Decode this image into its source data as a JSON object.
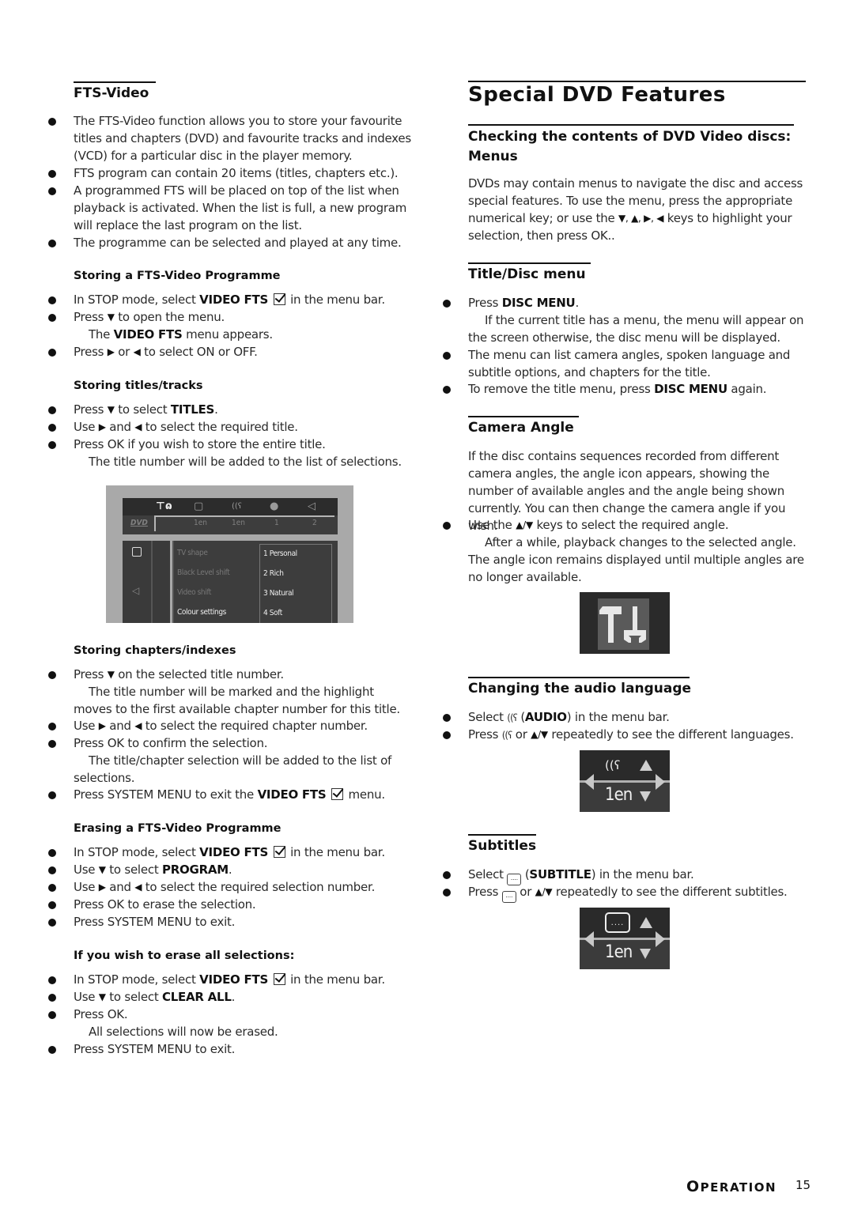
{
  "left": {
    "fts_heading": "FTS-Video",
    "intro_bullets": [
      "The FTS-Video function allows you to store your favourite titles and chapters (DVD) and favourite tracks and indexes (VCD) for a particular disc in the player memory.",
      "FTS program can contain 20 items (titles, chapters etc.).",
      "A programmed FTS will be placed on top of the list when playback is activated. When the list is full, a new program will replace the last program on the list.",
      "The programme can be selected and played at any time."
    ],
    "storing_programme": {
      "heading": "Storing a FTS-Video Programme",
      "b1_pre": "In STOP mode, select ",
      "b1_bold": "VIDEO FTS",
      "b1_post": " in the menu bar.",
      "b2_pre": "Press ",
      "b2_post": " to open the menu.",
      "b2_sub_pre": "The ",
      "b2_sub_bold": "VIDEO FTS",
      "b2_sub_post": " menu appears.",
      "b3_pre": "Press ",
      "b3_mid": " or ",
      "b3_post": "  to select ON or OFF."
    },
    "storing_titles": {
      "heading": "Storing titles/tracks",
      "b1_pre": "Press ",
      "b1_mid": " to select ",
      "b1_bold": "TITLES",
      "b1_post": ".",
      "b2_pre": "Use ",
      "b2_mid": " and ",
      "b2_post": " to select the required title.",
      "b3": "Press OK if you wish to store the entire title.",
      "b3_sub": "The title number will be added to the list of selections."
    },
    "osd_menu": {
      "top_values": [
        "1en",
        "1en",
        "1",
        "2"
      ],
      "disc_logo": "DVD",
      "labels": [
        "TV shape",
        "Black Level shift",
        "Video shift",
        "Colour settings"
      ],
      "options": [
        "1 Personal",
        "2 Rich",
        "3 Natural",
        "4 Soft"
      ]
    },
    "storing_chapters": {
      "heading": "Storing chapters/indexes",
      "b1_pre": "Press ",
      "b1_post": " on the selected title number.",
      "b1_sub": "The title number will be marked and the highlight moves to the first available chapter number for this title.",
      "b2_pre": "Use ",
      "b2_mid": " and ",
      "b2_post": " to select the required chapter number.",
      "b3": "Press OK to confirm the selection.",
      "b3_sub": "The title/chapter selection will be added to the list of selections.",
      "b4_pre": "Press SYSTEM MENU to exit the ",
      "b4_bold": "VIDEO FTS",
      "b4_post": " menu."
    },
    "erasing_programme": {
      "heading": "Erasing a FTS-Video Programme",
      "b1_pre": "In STOP mode, select ",
      "b1_bold": "VIDEO FTS",
      "b1_post": " in the menu bar.",
      "b2_pre": "Use ",
      "b2_mid": " to select ",
      "b2_bold": "PROGRAM",
      "b2_post": ".",
      "b3_pre": "Use ",
      "b3_mid": " and ",
      "b3_post": " to select the required selection number.",
      "b4": "Press OK to erase the selection.",
      "b5": "Press SYSTEM MENU to exit."
    },
    "erase_all": {
      "heading": "If you wish to erase all selections:",
      "b1_pre": "In STOP mode, select ",
      "b1_bold": "VIDEO FTS",
      "b1_post": " in the menu bar.",
      "b2_pre": "Use ",
      "b2_mid": " to select ",
      "b2_bold": "CLEAR ALL",
      "b2_post": ".",
      "b3": "Press OK.",
      "b3_sub": "All selections will now be erased.",
      "b4": "Press SYSTEM MENU to exit."
    }
  },
  "right": {
    "title": "Special DVD Features",
    "menus": {
      "heading": "Checking the contents of DVD Video discs: Menus",
      "para_pre": "DVDs may contain menus to navigate the disc and access special features. To use the menu, press the appropriate numerical key; or use the ",
      "para_post": " keys to highlight your selection, then press OK.."
    },
    "title_disc": {
      "heading": "Title/Disc menu",
      "b1_pre": "Press ",
      "b1_bold": "DISC MENU",
      "b1_post": ".",
      "b1_sub": "If the current title has a menu, the menu will appear on the screen otherwise, the disc menu will be displayed.",
      "b2": "The menu can list camera angles, spoken language and subtitle options, and chapters for the title.",
      "b3_pre": "To remove the title menu, press ",
      "b3_bold": "DISC MENU",
      "b3_post": " again."
    },
    "camera": {
      "heading": "Camera Angle",
      "para": "If the disc contains sequences recorded from different camera angles, the angle icon appears, showing the number of available angles and the angle being shown currently. You can then change the camera angle if you wish.",
      "b1_pre": "Use the ",
      "b1_keys": "▲/▼",
      "b1_post": " keys to select the required angle.",
      "b1_sub": "After a while, playback changes to the selected angle. The angle  icon remains displayed until multiple angles are no longer available."
    },
    "audio": {
      "heading": "Changing the audio language",
      "b1_pre": "Select ",
      "b1_open": " (",
      "b1_bold": "AUDIO",
      "b1_post": ") in the menu bar.",
      "b2_pre": "Press ",
      "b2_mid": " or ",
      "b2_keys": "▲/▼",
      "b2_post": " repeatedly to see the different languages.",
      "tile_lang": "1en"
    },
    "subtitles": {
      "heading": "Subtitles",
      "b1_pre": "Select ",
      "b1_open": " (",
      "b1_bold": "SUBTITLE",
      "b1_post": ") in the menu bar.",
      "b2_pre": "Press ",
      "b2_mid": " or ",
      "b2_keys": "▲/▼",
      "b2_post": " repeatedly to see the different subtitles.",
      "tile_lang": "1en",
      "icon_text": "...."
    }
  },
  "footer": {
    "section_first": "O",
    "section_rest": "PERATION",
    "page_number": "15"
  },
  "glyphs": {
    "down": "▼",
    "up": "▲",
    "right": "▶",
    "left": "◀",
    "nav_keys": "▼, ▲, ▶, ◀",
    "audio": "((ʕ"
  }
}
